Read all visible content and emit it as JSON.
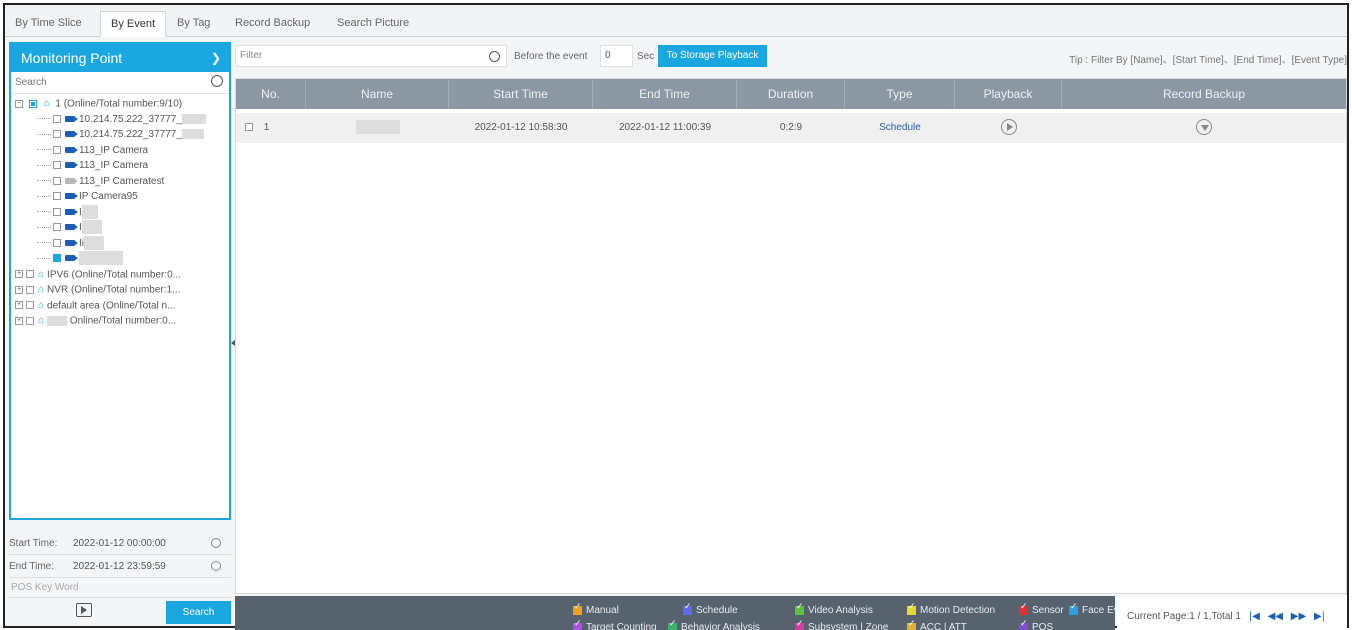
{
  "tabs": [
    "By Time Slice",
    "By Event",
    "By Tag",
    "Record Backup",
    "Search Picture"
  ],
  "active_tab": 1,
  "sidebar": {
    "title": "Monitoring Point",
    "search_placeholder": "Search",
    "root": "1 (Online/Total number:9/10)",
    "cameras": [
      {
        "label": "10.214.75.222_37777_",
        "state": "online"
      },
      {
        "label": "10.214.75.222_37777_",
        "state": "online"
      },
      {
        "label": "113_IP Camera",
        "state": "online"
      },
      {
        "label": "113_IP Camera",
        "state": "online"
      },
      {
        "label": "113_IP Cameratest",
        "state": "offline"
      },
      {
        "label": "IP Camera95",
        "state": "online"
      },
      {
        "label": "I",
        "state": "online"
      },
      {
        "label": "I",
        "state": "online"
      },
      {
        "label": "Ii",
        "state": "online"
      },
      {
        "label": "",
        "state": "online"
      }
    ],
    "groups": [
      "IPV6 (Online/Total number:0...",
      "NVR (Online/Total number:1...",
      "default area (Online/Total n...",
      "Online/Total number:0..."
    ],
    "start_time_label": "Start Time:",
    "start_time": "2022-01-12 00:00:00",
    "end_time_label": "End Time:",
    "end_time": "2022-01-12 23:59:59",
    "pos_placeholder": "POS Key Word",
    "search_button": "Search"
  },
  "filterbar": {
    "filter_placeholder": "Filter",
    "before_label": "Before the event",
    "before_value": "0",
    "sec_label": "Sec",
    "storage_button": "To Storage Playback",
    "tip": "Tip : Filter By [Name]、[Start Time]、[End Time]、[Event Type]"
  },
  "table": {
    "headers": [
      "No.",
      "Name",
      "Start Time",
      "End Time",
      "Duration",
      "Type",
      "Playback",
      "Record Backup"
    ],
    "rows": [
      {
        "no": "1",
        "name": "",
        "start": "2022-01-12 10:58:30",
        "end": "2022-01-12 11:00:39",
        "duration": "0:2:9",
        "type": "Schedule"
      }
    ]
  },
  "legend": [
    {
      "label": "Manual",
      "color": "#f0a020"
    },
    {
      "label": "Schedule",
      "color": "#5b6cf0"
    },
    {
      "label": "Video Analysis",
      "color": "#60c040"
    },
    {
      "label": "Motion Detection",
      "color": "#e6d830"
    },
    {
      "label": "Sensor",
      "color": "#e03030"
    },
    {
      "label": "Face Event",
      "color": "#2aa0e0"
    },
    {
      "label": "Target Counting",
      "color": "#b050e0"
    },
    {
      "label": "Behavior Analysis",
      "color": "#40b070"
    },
    {
      "label": "Subsystem | Zone",
      "color": "#d040a0"
    },
    {
      "label": "ACC | ATT",
      "color": "#e0b030"
    },
    {
      "label": "POS",
      "color": "#8050d0"
    }
  ],
  "pager": {
    "text": "Current Page:1 / 1,Total 1",
    "first": "|◀",
    "prev": "◀◀",
    "next": "▶▶",
    "last": "▶|"
  }
}
